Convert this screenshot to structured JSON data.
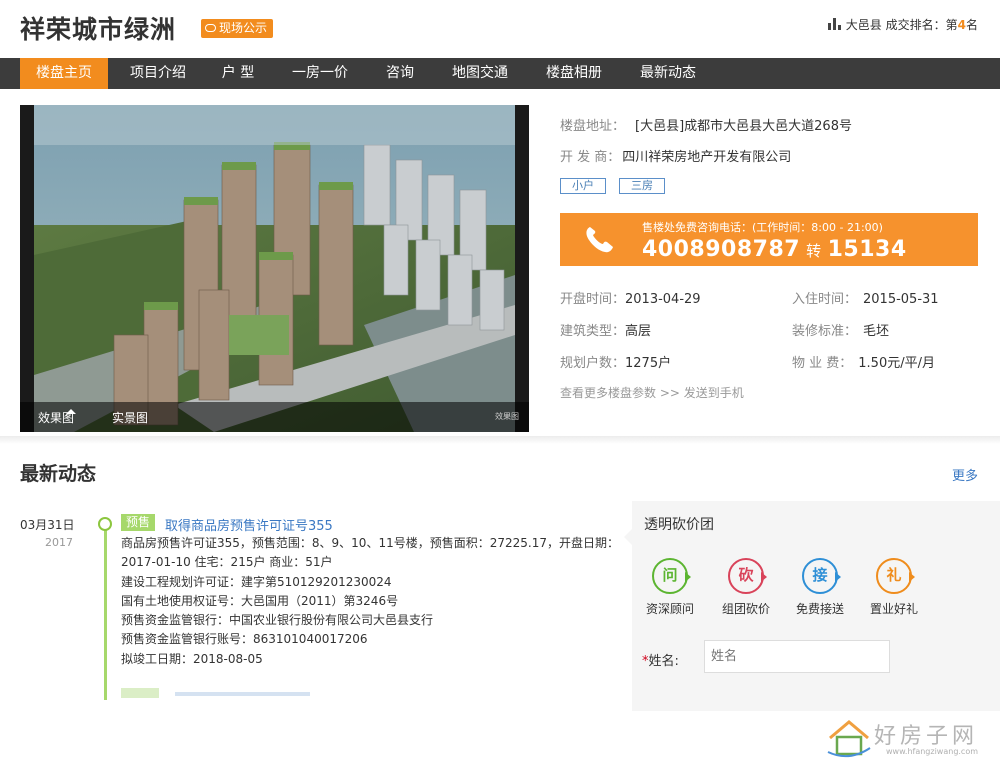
{
  "header": {
    "title": "祥荣城市绿洲",
    "tag": "现场公示",
    "rank_prefix": "大邑县 成交排名：第",
    "rank_num": "4",
    "rank_suffix": "名"
  },
  "nav": [
    "楼盘主页",
    "项目介绍",
    "户 型",
    "一房一价",
    "咨询",
    "地图交通",
    "楼盘相册",
    "最新动态"
  ],
  "photo": {
    "tabs": [
      "效果图",
      "实景图"
    ],
    "watermark": "效果图"
  },
  "info": {
    "address_label": "楼盘地址：",
    "address": "[大邑县]成都市大邑县大邑大道268号",
    "developer_label": "开 发 商：",
    "developer": "四川祥荣房地产开发有限公司",
    "tags": [
      "小户",
      "三房"
    ],
    "phone_hint": "售楼处免费咨询电话：(工作时间：8:00 - 21:00)",
    "phone_main": "4008908787",
    "phone_sep": "转",
    "phone_ext": "15134",
    "open_label": "开盘时间：",
    "open": "2013-04-29",
    "move_label": "入住时间：",
    "move": "2015-05-31",
    "type_label": "建筑类型：",
    "type": "高层",
    "deco_label": "装修标准：",
    "deco": "毛坯",
    "units_label": "规划户数：",
    "units": "1275户",
    "fee_label": "物 业 费：",
    "fee": "1.50元/平/月",
    "more_params": "查看更多楼盘参数 >> 发送到手机"
  },
  "news": {
    "title": "最新动态",
    "more": "更多",
    "date": "03月31日",
    "year": "2017",
    "tag": "预售",
    "link": "取得商品房预售许可证号355",
    "lines": [
      "商品房预售许可证355，预售范围：8、9、10、11号楼，预售面积：27225.17，开盘日期：",
      "2017-01-10 住宅：215户 商业：51户",
      "建设工程规划许可证：建字第510129201230024",
      "国有土地使用权证号：大邑国用（2011）第3246号",
      "预售资金监管银行：中国农业银行股份有限公司大邑县支行",
      "预售资金监管银行账号：863101040017206",
      "拟竣工日期：2018-08-05"
    ]
  },
  "panel": {
    "title": "透明砍价团",
    "services": [
      {
        "glyph": "问",
        "label": "资深顾问",
        "color": "#5cb531"
      },
      {
        "glyph": "砍",
        "label": "组团砍价",
        "color": "#d9435a"
      },
      {
        "glyph": "接",
        "label": "免费接送",
        "color": "#2e8fd6"
      },
      {
        "glyph": "礼",
        "label": "置业好礼",
        "color": "#ef8c1c"
      }
    ],
    "name_label": "姓名:",
    "name_placeholder": "姓名"
  },
  "footer": {
    "logo_text": "好房子网",
    "logo_url": "www.hfangziwang.com"
  }
}
